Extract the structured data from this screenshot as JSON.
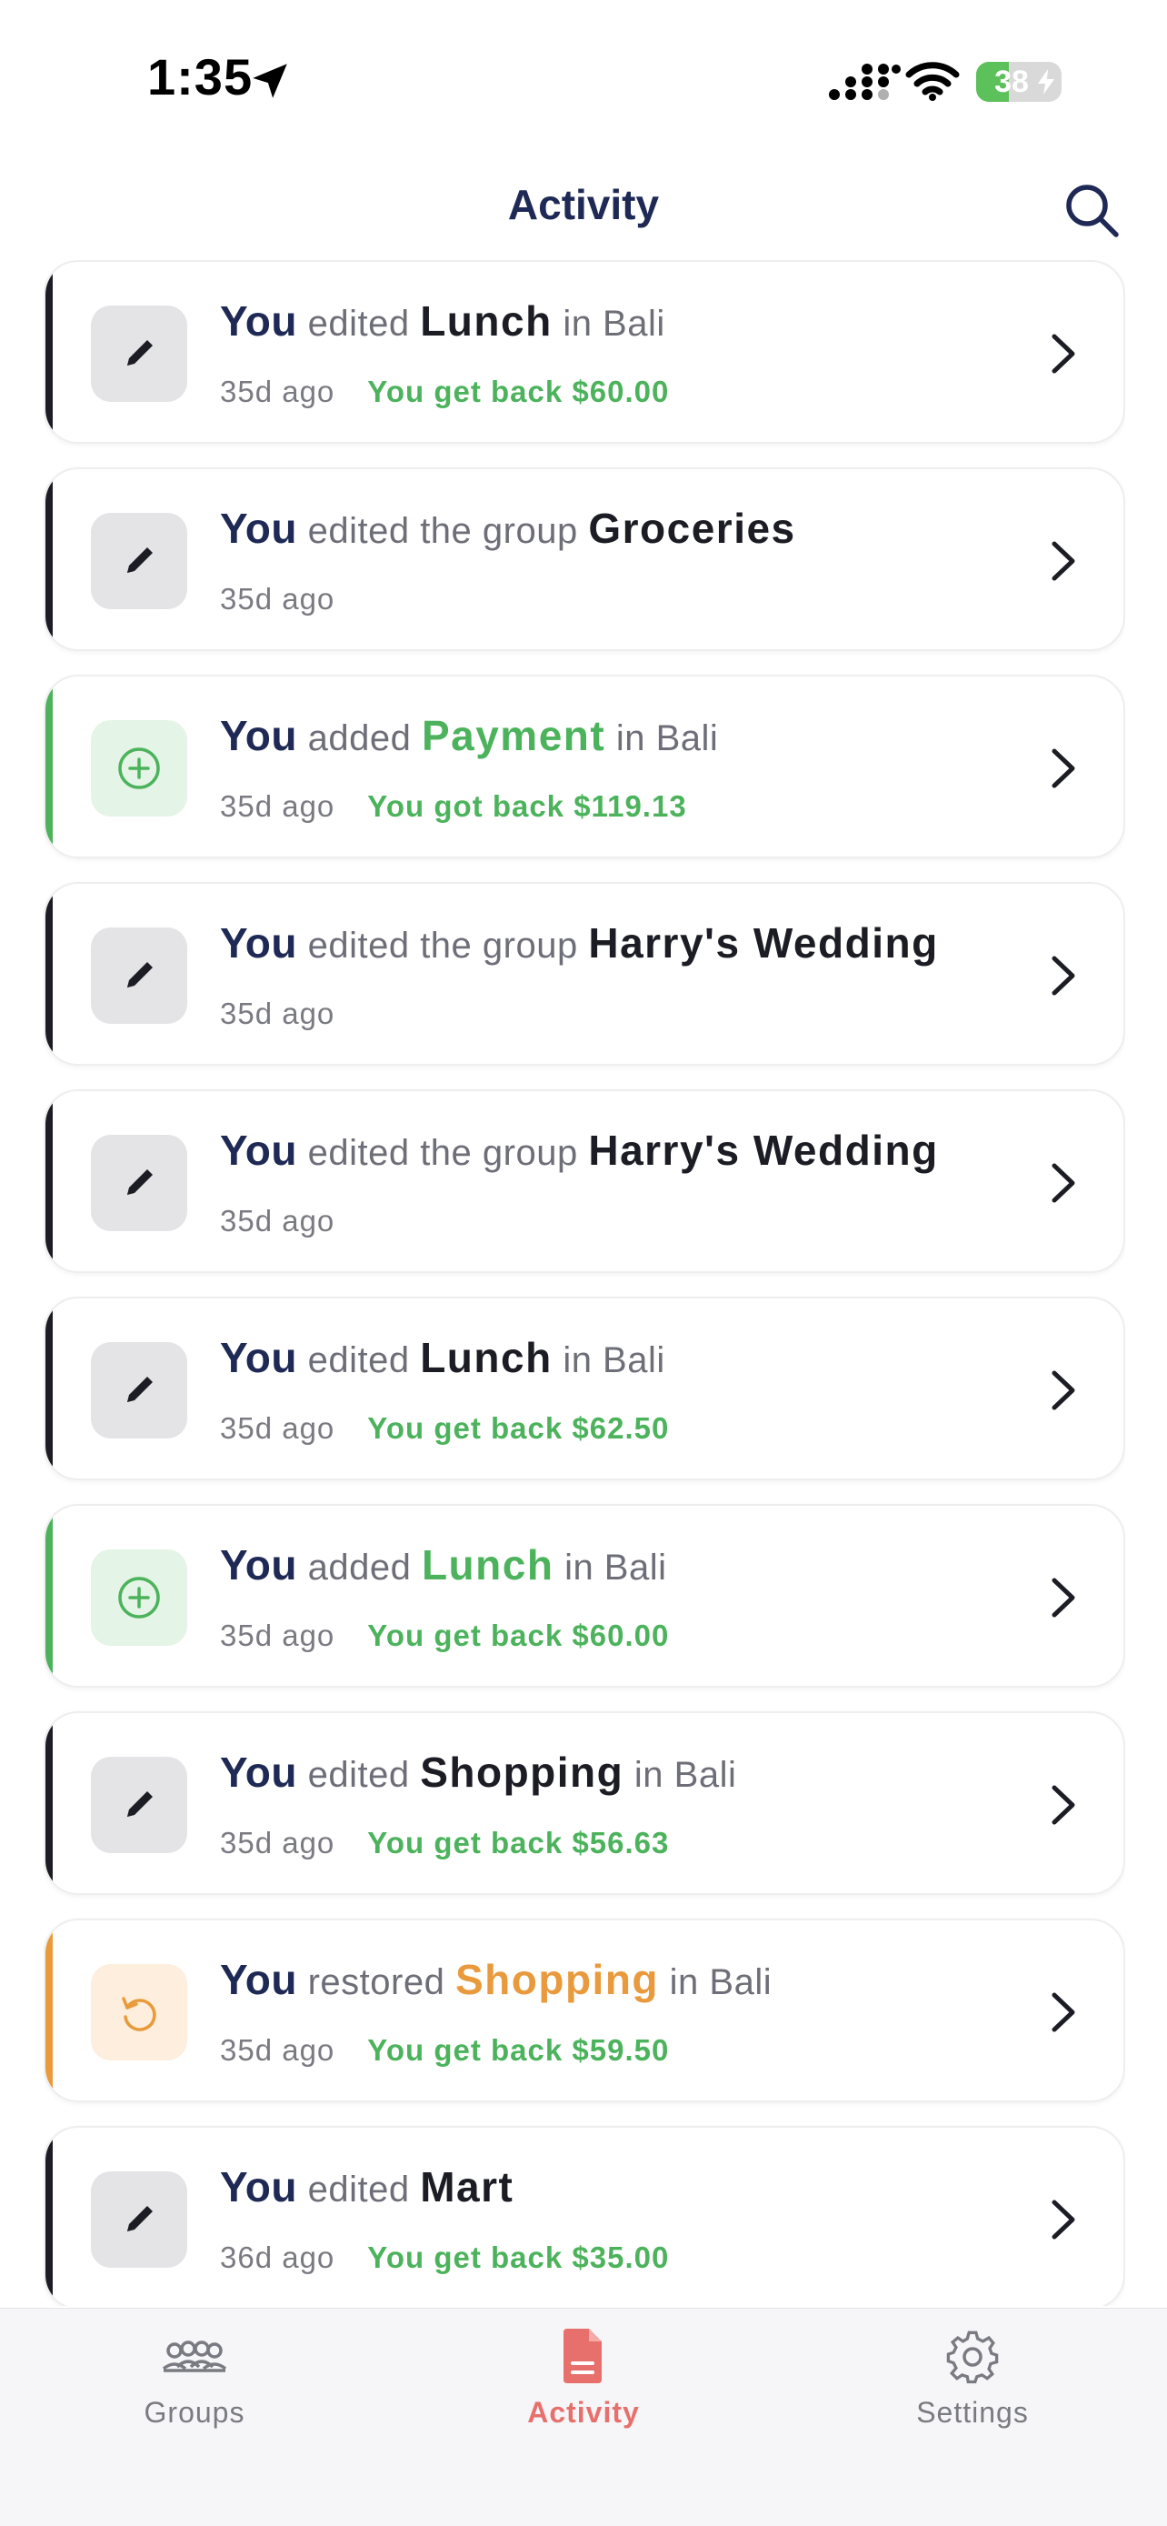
{
  "status": {
    "time": "1:35",
    "battery": "38",
    "battery_level": 0.38
  },
  "header": {
    "title": "Activity"
  },
  "colors": {
    "navy": "#1e2a55",
    "green": "#4cb35c",
    "orange": "#e89a3c",
    "dark": "#1c1c24",
    "gray_text": "#6e6e78",
    "tab_active": "#e8706c"
  },
  "activities": [
    {
      "kind": "edit",
      "icon": "pencil-icon",
      "actor": "You",
      "verb": "edited",
      "subject": "Lunch",
      "context": "in Bali",
      "ago": "35d ago",
      "amount": "You get back $60.00"
    },
    {
      "kind": "edit",
      "icon": "pencil-icon",
      "actor": "You",
      "verb": "edited the group",
      "subject": "Groceries",
      "context": "",
      "ago": "35d ago",
      "amount": ""
    },
    {
      "kind": "add",
      "icon": "plus-circle-icon",
      "actor": "You",
      "verb": "added",
      "subject": "Payment",
      "context": "in Bali",
      "ago": "35d ago",
      "amount": "You got back $119.13"
    },
    {
      "kind": "edit",
      "icon": "pencil-icon",
      "actor": "You",
      "verb": "edited the group",
      "subject": "Harry's Wedding",
      "context": "",
      "ago": "35d ago",
      "amount": ""
    },
    {
      "kind": "edit",
      "icon": "pencil-icon",
      "actor": "You",
      "verb": "edited the group",
      "subject": "Harry's Wedding",
      "context": "",
      "ago": "35d ago",
      "amount": ""
    },
    {
      "kind": "edit",
      "icon": "pencil-icon",
      "actor": "You",
      "verb": "edited",
      "subject": "Lunch",
      "context": "in Bali",
      "ago": "35d ago",
      "amount": "You get back $62.50"
    },
    {
      "kind": "add",
      "icon": "plus-circle-icon",
      "actor": "You",
      "verb": "added",
      "subject": "Lunch",
      "context": "in Bali",
      "ago": "35d ago",
      "amount": "You get back $60.00"
    },
    {
      "kind": "edit",
      "icon": "pencil-icon",
      "actor": "You",
      "verb": "edited",
      "subject": "Shopping",
      "context": "in Bali",
      "ago": "35d ago",
      "amount": "You get back $56.63"
    },
    {
      "kind": "restore",
      "icon": "restore-icon",
      "actor": "You",
      "verb": "restored",
      "subject": "Shopping",
      "context": "in Bali",
      "ago": "35d ago",
      "amount": "You get back $59.50"
    },
    {
      "kind": "edit",
      "icon": "pencil-icon",
      "actor": "You",
      "verb": "edited",
      "subject": "Mart",
      "context": "",
      "ago": "36d ago",
      "amount": "You get back $35.00"
    }
  ],
  "tabs": [
    {
      "label": "Groups",
      "icon": "groups-icon",
      "active": false
    },
    {
      "label": "Activity",
      "icon": "document-icon",
      "active": true
    },
    {
      "label": "Settings",
      "icon": "gear-icon",
      "active": false
    }
  ]
}
